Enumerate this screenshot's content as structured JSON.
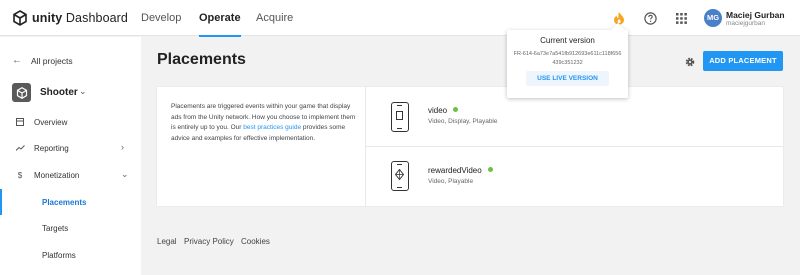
{
  "header": {
    "logo_bold": "unity",
    "logo_text": " Dashboard",
    "tabs": [
      {
        "label": "Develop"
      },
      {
        "label": "Operate"
      },
      {
        "label": "Acquire"
      }
    ],
    "icons": [
      "flame-icon",
      "help-icon",
      "apps-grid-icon"
    ],
    "user": {
      "initials": "MG",
      "name": "Maciej Gurban",
      "email": "maciejgurban"
    }
  },
  "sidebar": {
    "back_label": "All projects",
    "project_name": "Shooter",
    "items": [
      {
        "label": "Overview",
        "icon": "dashboard-icon"
      },
      {
        "label": "Reporting",
        "icon": "trending-icon"
      },
      {
        "label": "Monetization",
        "icon": "dollar-icon"
      }
    ],
    "subitems": [
      {
        "label": "Placements"
      },
      {
        "label": "Targets"
      },
      {
        "label": "Platforms"
      }
    ]
  },
  "main": {
    "title": "Placements",
    "add_button": "ADD PLACEMENT",
    "description_pre": "Placements are triggered events within your game that display ads from the Unity network. How you choose to implement them is entirely up to you. Our ",
    "description_link": "best practices guide",
    "description_post": " provides some advice and examples for effective implementation.",
    "placements": [
      {
        "name": "video",
        "types": "Video, Display, Playable",
        "status_color": "#6cc04a"
      },
      {
        "name": "rewardedVideo",
        "types": "Video, Playable",
        "status_color": "#6cc04a"
      }
    ]
  },
  "footer": {
    "links": [
      "Legal",
      "Privacy Policy",
      "Cookies"
    ]
  },
  "popover": {
    "title": "Current version",
    "hash": "FR-614-6a73e7a541fb912693e611c118f656439c351232",
    "button": "USE LIVE VERSION"
  },
  "colors": {
    "accent": "#2196f3",
    "status_green": "#6cc04a",
    "flame": "#f5a623"
  }
}
